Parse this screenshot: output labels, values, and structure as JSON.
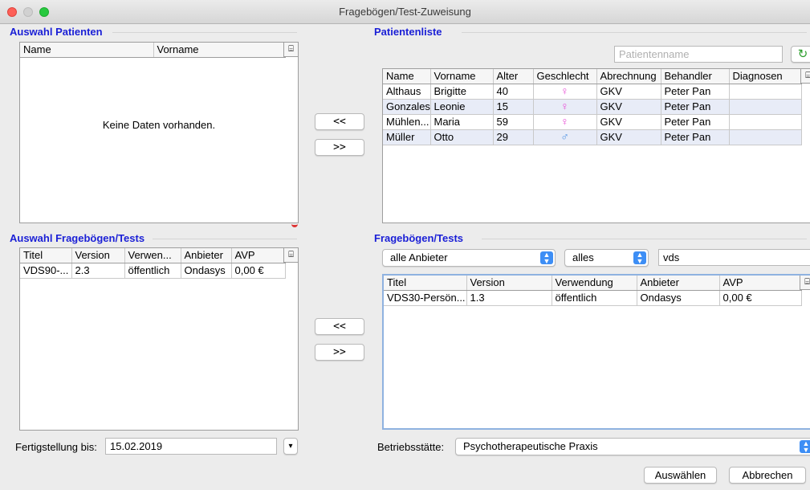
{
  "window": {
    "title": "Fragebögen/Test-Zuweisung"
  },
  "auswahl_patienten": {
    "title": "Auswahl Patienten",
    "columns": [
      "Name",
      "Vorname"
    ],
    "empty_text": "Keine Daten vorhanden."
  },
  "patientenliste": {
    "title": "Patientenliste",
    "search_placeholder": "Patientenname",
    "columns": [
      "Name",
      "Vorname",
      "Alter",
      "Geschlecht",
      "Abrechnung",
      "Behandler",
      "Diagnosen"
    ],
    "rows": [
      {
        "name": "Althaus",
        "vorname": "Brigitte",
        "alter": "40",
        "geschlecht": "female",
        "abrechnung": "GKV",
        "behandler": "Peter Pan",
        "diagnosen": ""
      },
      {
        "name": "Gonzales",
        "vorname": "Leonie",
        "alter": "15",
        "geschlecht": "female",
        "abrechnung": "GKV",
        "behandler": "Peter Pan",
        "diagnosen": ""
      },
      {
        "name": "Mühlen...",
        "vorname": "Maria",
        "alter": "59",
        "geschlecht": "female",
        "abrechnung": "GKV",
        "behandler": "Peter Pan",
        "diagnosen": ""
      },
      {
        "name": "Müller",
        "vorname": "Otto",
        "alter": "29",
        "geschlecht": "male",
        "abrechnung": "GKV",
        "behandler": "Peter Pan",
        "diagnosen": ""
      }
    ]
  },
  "transfer": {
    "left": "<<",
    "right": ">>"
  },
  "auswahl_frageboegen": {
    "title": "Auswahl Fragebögen/Tests",
    "columns": [
      "Titel",
      "Version",
      "Verwen...",
      "Anbieter",
      "AVP"
    ],
    "rows": [
      {
        "titel": "VDS90-...",
        "version": "2.3",
        "verwendung": "öffentlich",
        "anbieter": "Ondasys",
        "avp": "0,00 €"
      }
    ]
  },
  "frageboegen": {
    "title": "Fragebögen/Tests",
    "filter_anbieter": "alle Anbieter",
    "filter_scope": "alles",
    "search_value": "vds",
    "columns": [
      "Titel",
      "Version",
      "Verwendung",
      "Anbieter",
      "AVP"
    ],
    "rows": [
      {
        "titel": "VDS30-Persön...",
        "version": "1.3",
        "verwendung": "öffentlich",
        "anbieter": "Ondasys",
        "avp": "0,00 €"
      }
    ]
  },
  "fertigstellung": {
    "label": "Fertigstellung bis:",
    "value": "15.02.2019"
  },
  "betriebsstaette": {
    "label": "Betriebsstätte:",
    "value": "Psychotherapeutische Praxis"
  },
  "actions": {
    "select": "Auswählen",
    "cancel": "Abbrechen"
  },
  "icons": {
    "female": "♀",
    "male": "♂",
    "refresh": "↻",
    "column-chooser": "⌸",
    "dropdown": "▾"
  }
}
